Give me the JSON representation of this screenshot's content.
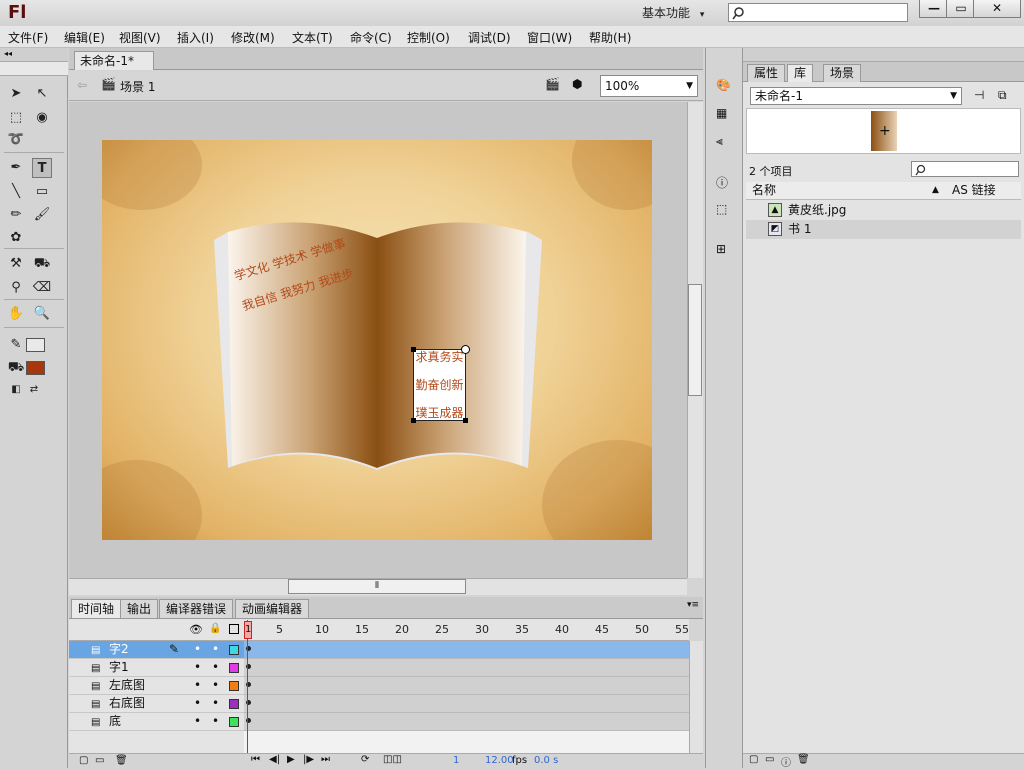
{
  "app": {
    "logo": "Fl",
    "workspace": "基本功能",
    "workspace_arrow": "▾"
  },
  "window_buttons": {
    "minimize": "—",
    "restore": "▭",
    "close": "✕"
  },
  "menu": [
    "文件(F)",
    "编辑(E)",
    "视图(V)",
    "插入(I)",
    "修改(M)",
    "文本(T)",
    "命令(C)",
    "控制(O)",
    "调试(D)",
    "窗口(W)",
    "帮助(H)"
  ],
  "document": {
    "tab_title": "未命名-1*",
    "tab_close": "×",
    "scene": "场景 1",
    "zoom": "100%"
  },
  "stage": {
    "book_text_line1": "学文化 学技术 学做事",
    "book_text_line2": "我自信 我努力 我进步",
    "box_lines": [
      "求真务实",
      "勤奋创新",
      "璞玉成器"
    ],
    "colors": {
      "paper": "#f0d297",
      "book_dark": "#8a4f12",
      "text": "#b24a1a"
    }
  },
  "timeline": {
    "tabs": [
      "时间轴",
      "输出",
      "编译器错误",
      "动画编辑器"
    ],
    "active_tab": "时间轴",
    "ruler": [
      "1",
      "5",
      "10",
      "15",
      "20",
      "25",
      "30",
      "35",
      "40",
      "45",
      "50",
      "55"
    ],
    "layers": [
      {
        "name": "字2",
        "color": "#3fd6e6",
        "selected": true
      },
      {
        "name": "字1",
        "color": "#e23ce6",
        "selected": false
      },
      {
        "name": "左底图",
        "color": "#f07f10",
        "selected": false
      },
      {
        "name": "右底图",
        "color": "#9a2fc0",
        "selected": false
      },
      {
        "name": "底",
        "color": "#3fe05a",
        "selected": false
      }
    ],
    "status": {
      "frame": "1",
      "fps": "12.00",
      "fps_unit": "fps",
      "time": "0.0 s"
    }
  },
  "right_panel": {
    "tabs": [
      "属性",
      "库",
      "场景"
    ],
    "active_tab": "库",
    "library_select": "未命名-1",
    "item_count": "2 个项目",
    "columns": {
      "name": "名称",
      "linkage": "AS 链接"
    },
    "items": [
      {
        "name": "黄皮纸.jpg",
        "icon": "bitmap-icon"
      },
      {
        "name": "书 1",
        "icon": "graphic-symbol-icon"
      }
    ]
  }
}
